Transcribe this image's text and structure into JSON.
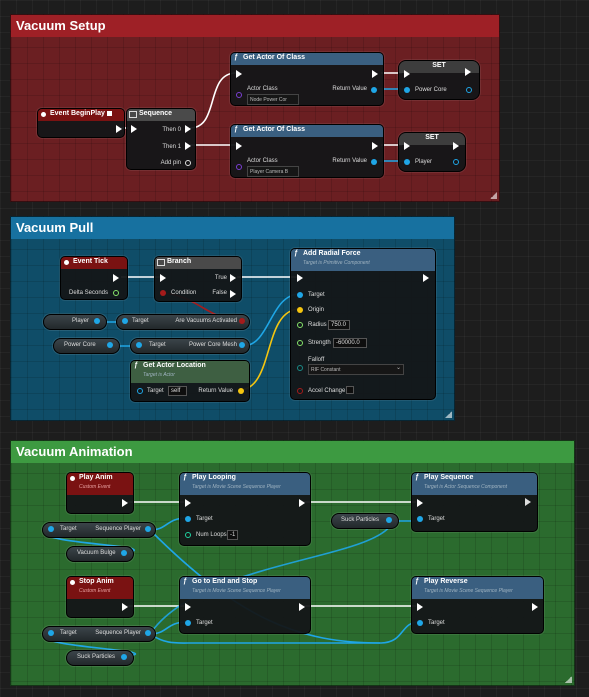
{
  "colors": {
    "setup_comment": "#6b1f22",
    "setup_title": "#9e2026",
    "pull_comment": "#0f4d68",
    "pull_title": "#1771a0",
    "anim_comment": "#2b6b2e",
    "anim_title": "#3d9a41",
    "event_head": "#7a1212",
    "function_head": "#3a5f80",
    "set_head": "#3d3d3d",
    "branch_head": "#4a4a4a",
    "pure_head": "#3e5f42",
    "exec_wire": "#ffffff",
    "object_pin": "#1fa6e6",
    "vector_pin": "#f5c50f",
    "float_pin": "#86e36a",
    "bool_pin": "#a51b1b",
    "class_pin": "#5a27b5"
  },
  "groups": {
    "setup": {
      "title": "Vacuum Setup",
      "event_begin_play": {
        "title": "Event BeginPlay"
      },
      "sequence": {
        "title": "Sequence",
        "then0": "Then 0",
        "then1": "Then 1",
        "add_pin": "Add pin"
      },
      "get_actor_1": {
        "title": "Get Actor Of Class",
        "actor_class_label": "Actor Class",
        "actor_class_value": "Node Power Cor",
        "return_label": "Return Value"
      },
      "get_actor_2": {
        "title": "Get Actor Of Class",
        "actor_class_label": "Actor Class",
        "actor_class_value": "Player Camera B",
        "return_label": "Return Value"
      },
      "set_1": {
        "title": "SET",
        "var": "Power Core"
      },
      "set_2": {
        "title": "SET",
        "var": "Player"
      }
    },
    "pull": {
      "title": "Vacuum Pull",
      "event_tick": {
        "title": "Event Tick",
        "delta": "Delta Seconds"
      },
      "branch": {
        "title": "Branch",
        "true": "True",
        "condition": "Condition",
        "false": "False"
      },
      "add_radial_force": {
        "title": "Add Radial Force",
        "subtitle": "Target is Primitive Component",
        "target": "Target",
        "origin": "Origin",
        "radius_label": "Radius",
        "radius_value": "750.0",
        "strength_label": "Strength",
        "strength_value": "-60000.0",
        "falloff_label": "Falloff",
        "falloff_value": "RIF Constant",
        "accel_label": "Accel Change"
      },
      "player_var": "Player",
      "player_getter": {
        "target": "Target",
        "prop": "Are Vacuums Activated"
      },
      "power_core_var": "Power Core",
      "power_core_getter": {
        "target": "Target",
        "prop": "Power Core Mesh"
      },
      "get_actor_location": {
        "title": "Get Actor Location",
        "subtitle": "Target is Actor",
        "target": "Target",
        "target_value": "self",
        "return": "Return Value"
      }
    },
    "anim": {
      "title": "Vacuum Animation",
      "play_anim": {
        "title": "Play Anim",
        "subtitle": "Custom Event"
      },
      "play_looping": {
        "title": "Play Looping",
        "subtitle": "Target is Movie Scene Sequence Player",
        "target": "Target",
        "num_loops_label": "Num Loops",
        "num_loops_value": "-1"
      },
      "play_sequence": {
        "title": "Play Sequence",
        "subtitle": "Target is Actor Sequence Component",
        "target": "Target"
      },
      "vb_getter1": {
        "target": "Target",
        "prop": "Sequence Player"
      },
      "vacuum_bulge_var": "Vacuum Bulge",
      "suck_particles_var1": "Suck Particles",
      "stop_anim": {
        "title": "Stop Anim",
        "subtitle": "Custom Event"
      },
      "go_to_end": {
        "title": "Go to End and Stop",
        "subtitle": "Target is Movie Scene Sequence Player",
        "target": "Target"
      },
      "play_reverse": {
        "title": "Play Reverse",
        "subtitle": "Target is Movie Scene Sequence Player",
        "target": "Target"
      },
      "vb_getter2": {
        "target": "Target",
        "prop": "Sequence Player"
      },
      "suck_particles_var2": "Suck Particles"
    }
  }
}
